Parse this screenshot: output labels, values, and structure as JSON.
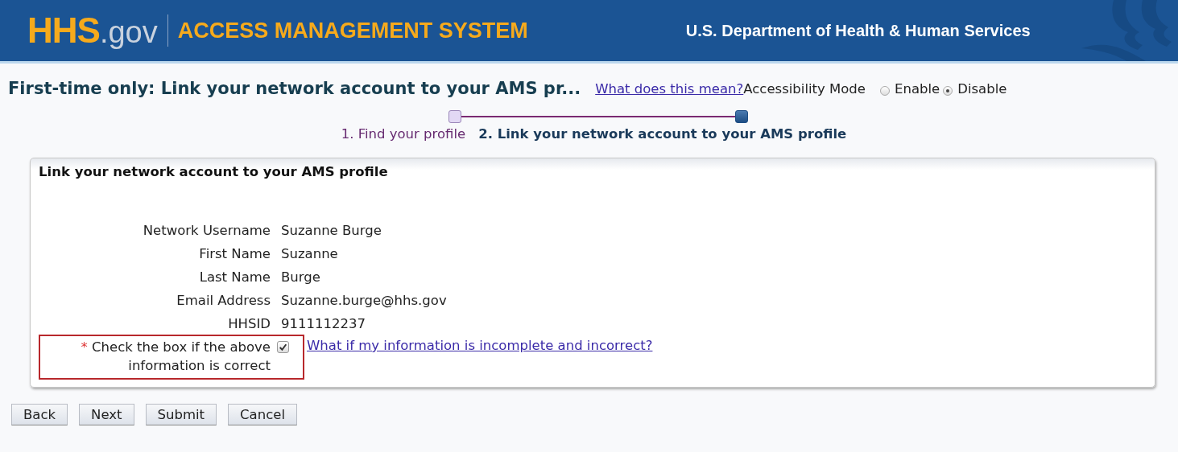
{
  "header": {
    "logo": {
      "brand": "HHS",
      "suffix": ".gov"
    },
    "system_name": "ACCESS MANAGEMENT SYSTEM",
    "department": "U.S. Department of Health & Human Services"
  },
  "page_title": "First-time only: Link your network account to your AMS pr...",
  "help_link": "What does this mean?",
  "accessibility": {
    "label": "Accessibility Mode",
    "options": [
      {
        "label": "Enable",
        "selected": false
      },
      {
        "label": "Disable",
        "selected": true
      }
    ]
  },
  "steps": [
    {
      "label": "1. Find your profile",
      "selected": false
    },
    {
      "label": "2. Link your network account to your AMS profile",
      "selected": true
    }
  ],
  "panel": {
    "title": "Link your network account to your AMS profile",
    "fields": [
      {
        "label": "Network Username",
        "value": "Suzanne Burge"
      },
      {
        "label": "First Name",
        "value": "Suzanne"
      },
      {
        "label": "Last Name",
        "value": "Burge"
      },
      {
        "label": "Email Address",
        "value": "Suzanne.burge@hhs.gov"
      },
      {
        "label": "HHSID",
        "value": "9111112237"
      }
    ],
    "confirm": {
      "required_mark": "*",
      "label": "Check the box if the above information is correct",
      "checked": true,
      "help_link": "What if my information is incomplete and incorrect?"
    }
  },
  "buttons": [
    "Back",
    "Next",
    "Submit",
    "Cancel"
  ]
}
